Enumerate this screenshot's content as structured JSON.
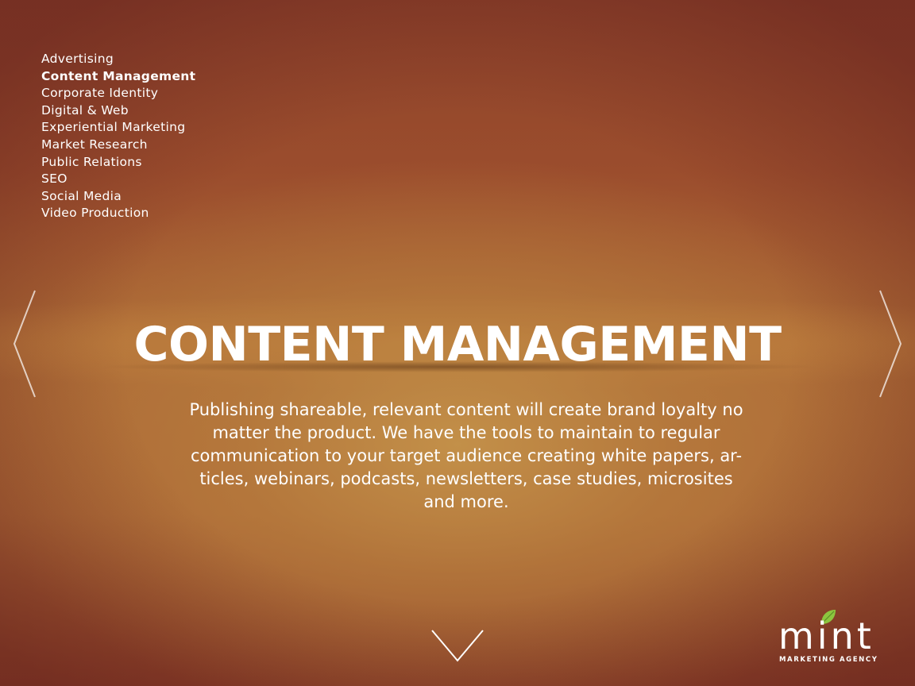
{
  "nav": {
    "items": [
      {
        "label": "Advertising",
        "active": false
      },
      {
        "label": "Content Management",
        "active": true
      },
      {
        "label": "Corporate Identity",
        "active": false
      },
      {
        "label": "Digital & Web",
        "active": false
      },
      {
        "label": "Experiential Marketing",
        "active": false
      },
      {
        "label": "Market Research",
        "active": false
      },
      {
        "label": "Public Relations",
        "active": false
      },
      {
        "label": "SEO",
        "active": false
      },
      {
        "label": "Social Media",
        "active": false
      },
      {
        "label": "Video Production",
        "active": false
      }
    ]
  },
  "main": {
    "title": "CONTENT MANAGEMENT",
    "body_lines": [
      "Publishing shareable, relevant content will create brand loyalty no",
      "matter the product. We have the tools to maintain to regular",
      "communication to your target audience creating white papers, ar-",
      "ticles, webinars, podcasts, newsletters, case studies, microsites",
      "and more."
    ]
  },
  "controls": {
    "prev_icon": "chevron-left-icon",
    "next_icon": "chevron-right-icon",
    "down_icon": "chevron-down-icon"
  },
  "logo": {
    "wordmark": "mint",
    "tagline": "MARKETING AGENCY",
    "leaf_color": "#8cc63f"
  },
  "colors": {
    "background_top": "#8e432b",
    "background_center": "#c4924a",
    "text": "#ffffff"
  }
}
